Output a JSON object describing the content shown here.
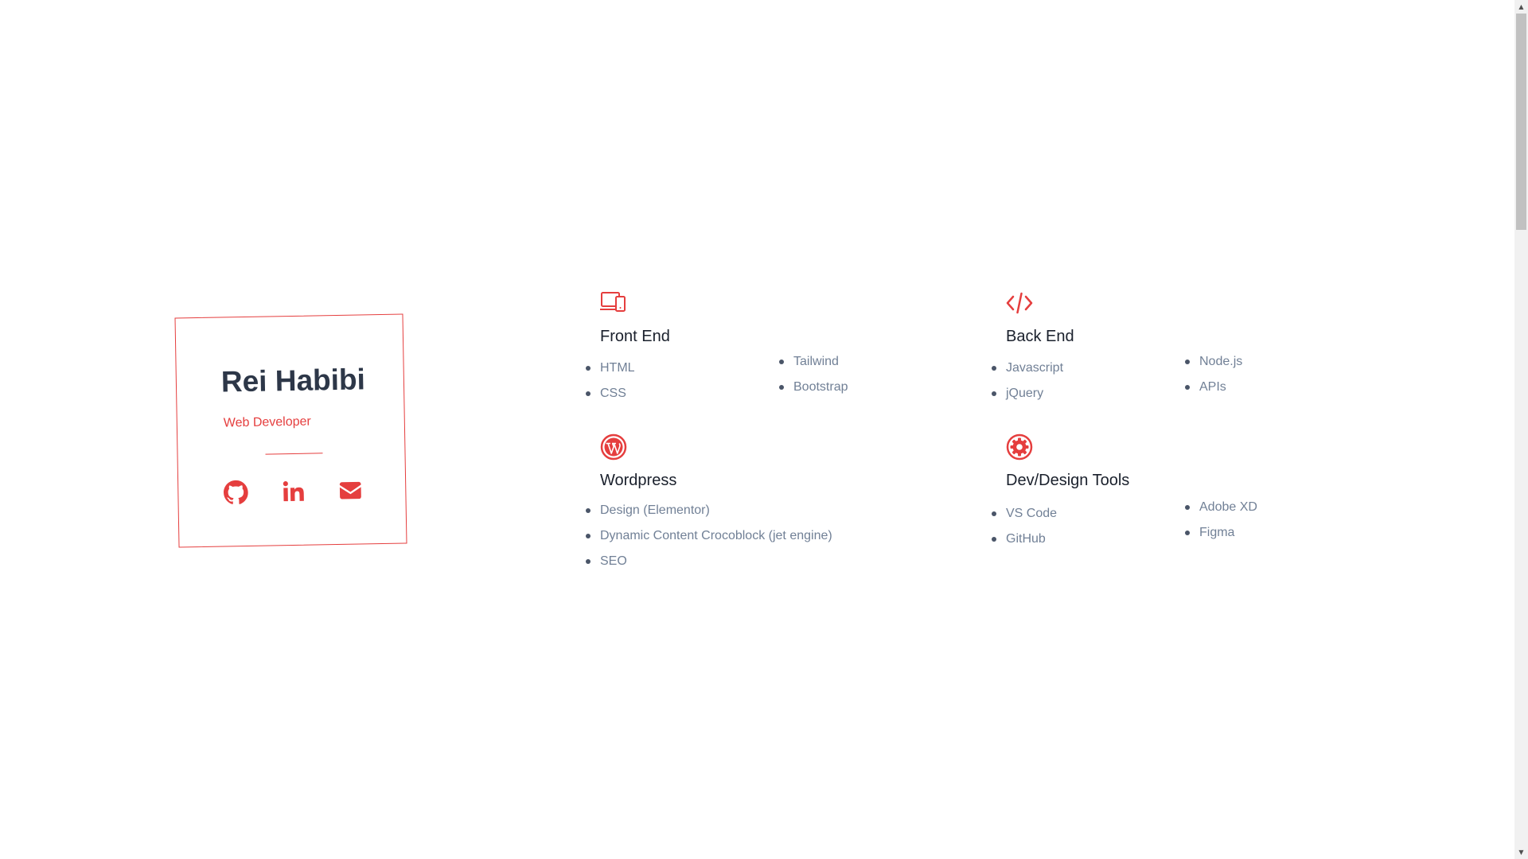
{
  "profile": {
    "name": "Rei Habibi",
    "role": "Web Developer",
    "social": [
      {
        "icon": "github-icon"
      },
      {
        "icon": "linkedin-icon"
      },
      {
        "icon": "envelope-icon"
      }
    ]
  },
  "accent_color": "#e53e3e",
  "skills": {
    "front_end": {
      "icon": "devices-icon",
      "title": "Front End",
      "col1": [
        "HTML",
        "CSS"
      ],
      "col2": [
        "Tailwind",
        "Bootstrap"
      ]
    },
    "back_end": {
      "icon": "code-icon",
      "title": "Back End",
      "col1": [
        "Javascript",
        "jQuery"
      ],
      "col2": [
        "Node.js",
        "APIs"
      ]
    },
    "wordpress": {
      "icon": "wordpress-icon",
      "title": "Wordpress",
      "col1": [
        "Design (Elementor)",
        "Dynamic Content Crocoblock (jet engine)",
        "SEO"
      ]
    },
    "tools": {
      "icon": "gear-icon",
      "title": "Dev/Design Tools",
      "col1": [
        "VS Code",
        "GitHub"
      ],
      "col2": [
        "Adobe XD",
        "Figma"
      ]
    }
  }
}
